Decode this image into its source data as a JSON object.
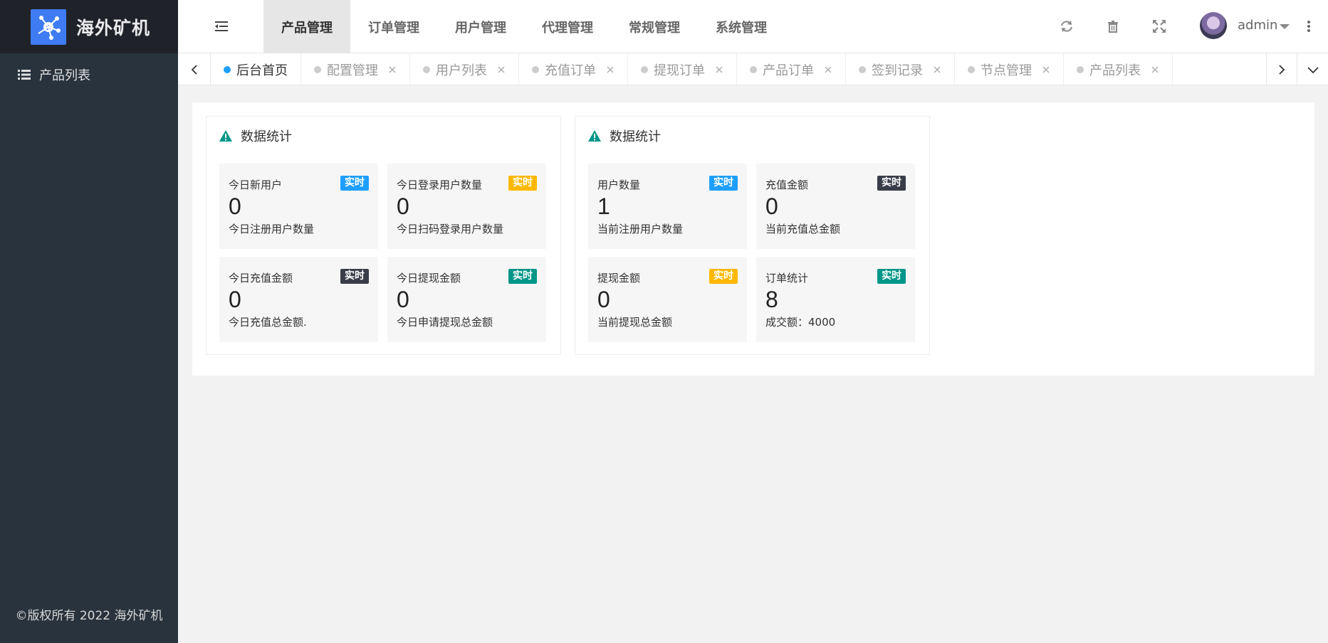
{
  "sidebar": {
    "logo_text": "海外矿机",
    "items": [
      {
        "label": "产品列表",
        "icon": "list-icon"
      }
    ],
    "copyright": "©版权所有 2022 海外矿机"
  },
  "topnav": {
    "items": [
      "产品管理",
      "订单管理",
      "用户管理",
      "代理管理",
      "常规管理",
      "系统管理"
    ],
    "active": "产品管理",
    "user": "admin"
  },
  "tabs": [
    {
      "label": "后台首页",
      "active": true
    },
    {
      "label": "配置管理"
    },
    {
      "label": "用户列表"
    },
    {
      "label": "充值订单"
    },
    {
      "label": "提现订单"
    },
    {
      "label": "产品订单"
    },
    {
      "label": "签到记录"
    },
    {
      "label": "节点管理"
    },
    {
      "label": "产品列表"
    }
  ],
  "colors": {
    "blue": "#1e9fff",
    "orange": "#ffb800",
    "dark": "#393d49",
    "teal": "#009688"
  },
  "panels": [
    {
      "title": "数据统计",
      "cards": [
        {
          "label": "今日新用户",
          "badge": "实时",
          "badge_color": "#1e9fff",
          "value": "0",
          "sub": "今日注册用户数量"
        },
        {
          "label": "今日登录用户数量",
          "badge": "实时",
          "badge_color": "#ffb800",
          "value": "0",
          "sub": "今日扫码登录用户数量"
        },
        {
          "label": "今日充值金额",
          "badge": "实时",
          "badge_color": "#393d49",
          "value": "0",
          "sub": "今日充值总金额."
        },
        {
          "label": "今日提现金额",
          "badge": "实时",
          "badge_color": "#009688",
          "value": "0",
          "sub": "今日申请提现总金额"
        }
      ]
    },
    {
      "title": "数据统计",
      "cards": [
        {
          "label": "用户数量",
          "badge": "实时",
          "badge_color": "#1e9fff",
          "value": "1",
          "sub": "当前注册用户数量"
        },
        {
          "label": "充值金额",
          "badge": "实时",
          "badge_color": "#393d49",
          "value": "0",
          "sub": "当前充值总金额"
        },
        {
          "label": "提现金额",
          "badge": "实时",
          "badge_color": "#ffb800",
          "value": "0",
          "sub": "当前提现总金额"
        },
        {
          "label": "订单统计",
          "badge": "实时",
          "badge_color": "#009688",
          "value": "8",
          "sub": "成交额：4000"
        }
      ]
    }
  ]
}
